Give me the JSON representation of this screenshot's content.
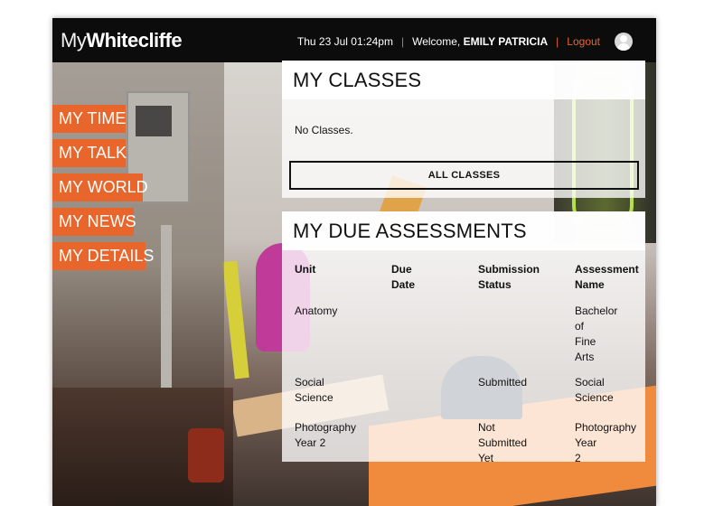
{
  "header": {
    "logo_prefix": "My",
    "logo_name": "Whitecliffe",
    "datetime": "Thu 23 Jul 01:24pm",
    "welcome_prefix": "Welcome,",
    "user_name": "EMILY PATRICIA",
    "logout_label": "Logout"
  },
  "nav": {
    "items": [
      {
        "label": "MY TIME"
      },
      {
        "label": "MY TALK"
      },
      {
        "label": "MY WORLD"
      },
      {
        "label": "MY NEWS"
      },
      {
        "label": "MY DETAILS"
      }
    ]
  },
  "classes": {
    "title": "MY CLASSES",
    "empty_text": "No Classes.",
    "all_button": "ALL CLASSES"
  },
  "assessments": {
    "title": "MY DUE ASSESSMENTS",
    "columns": {
      "unit": [
        "Unit"
      ],
      "due": [
        "Due",
        "Date"
      ],
      "status": [
        "Submission",
        "Status"
      ],
      "name": [
        "Assessment",
        "Name"
      ]
    },
    "rows": [
      {
        "unit": [
          "Anatomy"
        ],
        "due": [],
        "status": [],
        "name": [
          "Bachelor",
          "of",
          "Fine",
          "Arts"
        ]
      },
      {
        "unit": [
          "Social",
          "Science"
        ],
        "due": [],
        "status": [
          "Submitted"
        ],
        "name": [
          "Social",
          "Science"
        ]
      },
      {
        "unit": [
          "Photography",
          "Year 2"
        ],
        "due": [],
        "status": [
          "Not",
          "Submitted",
          "Yet"
        ],
        "name": [
          "Photography",
          "Year",
          "2"
        ]
      }
    ]
  },
  "colors": {
    "accent": "#e8662c",
    "topbar": "#0c0c0c"
  }
}
